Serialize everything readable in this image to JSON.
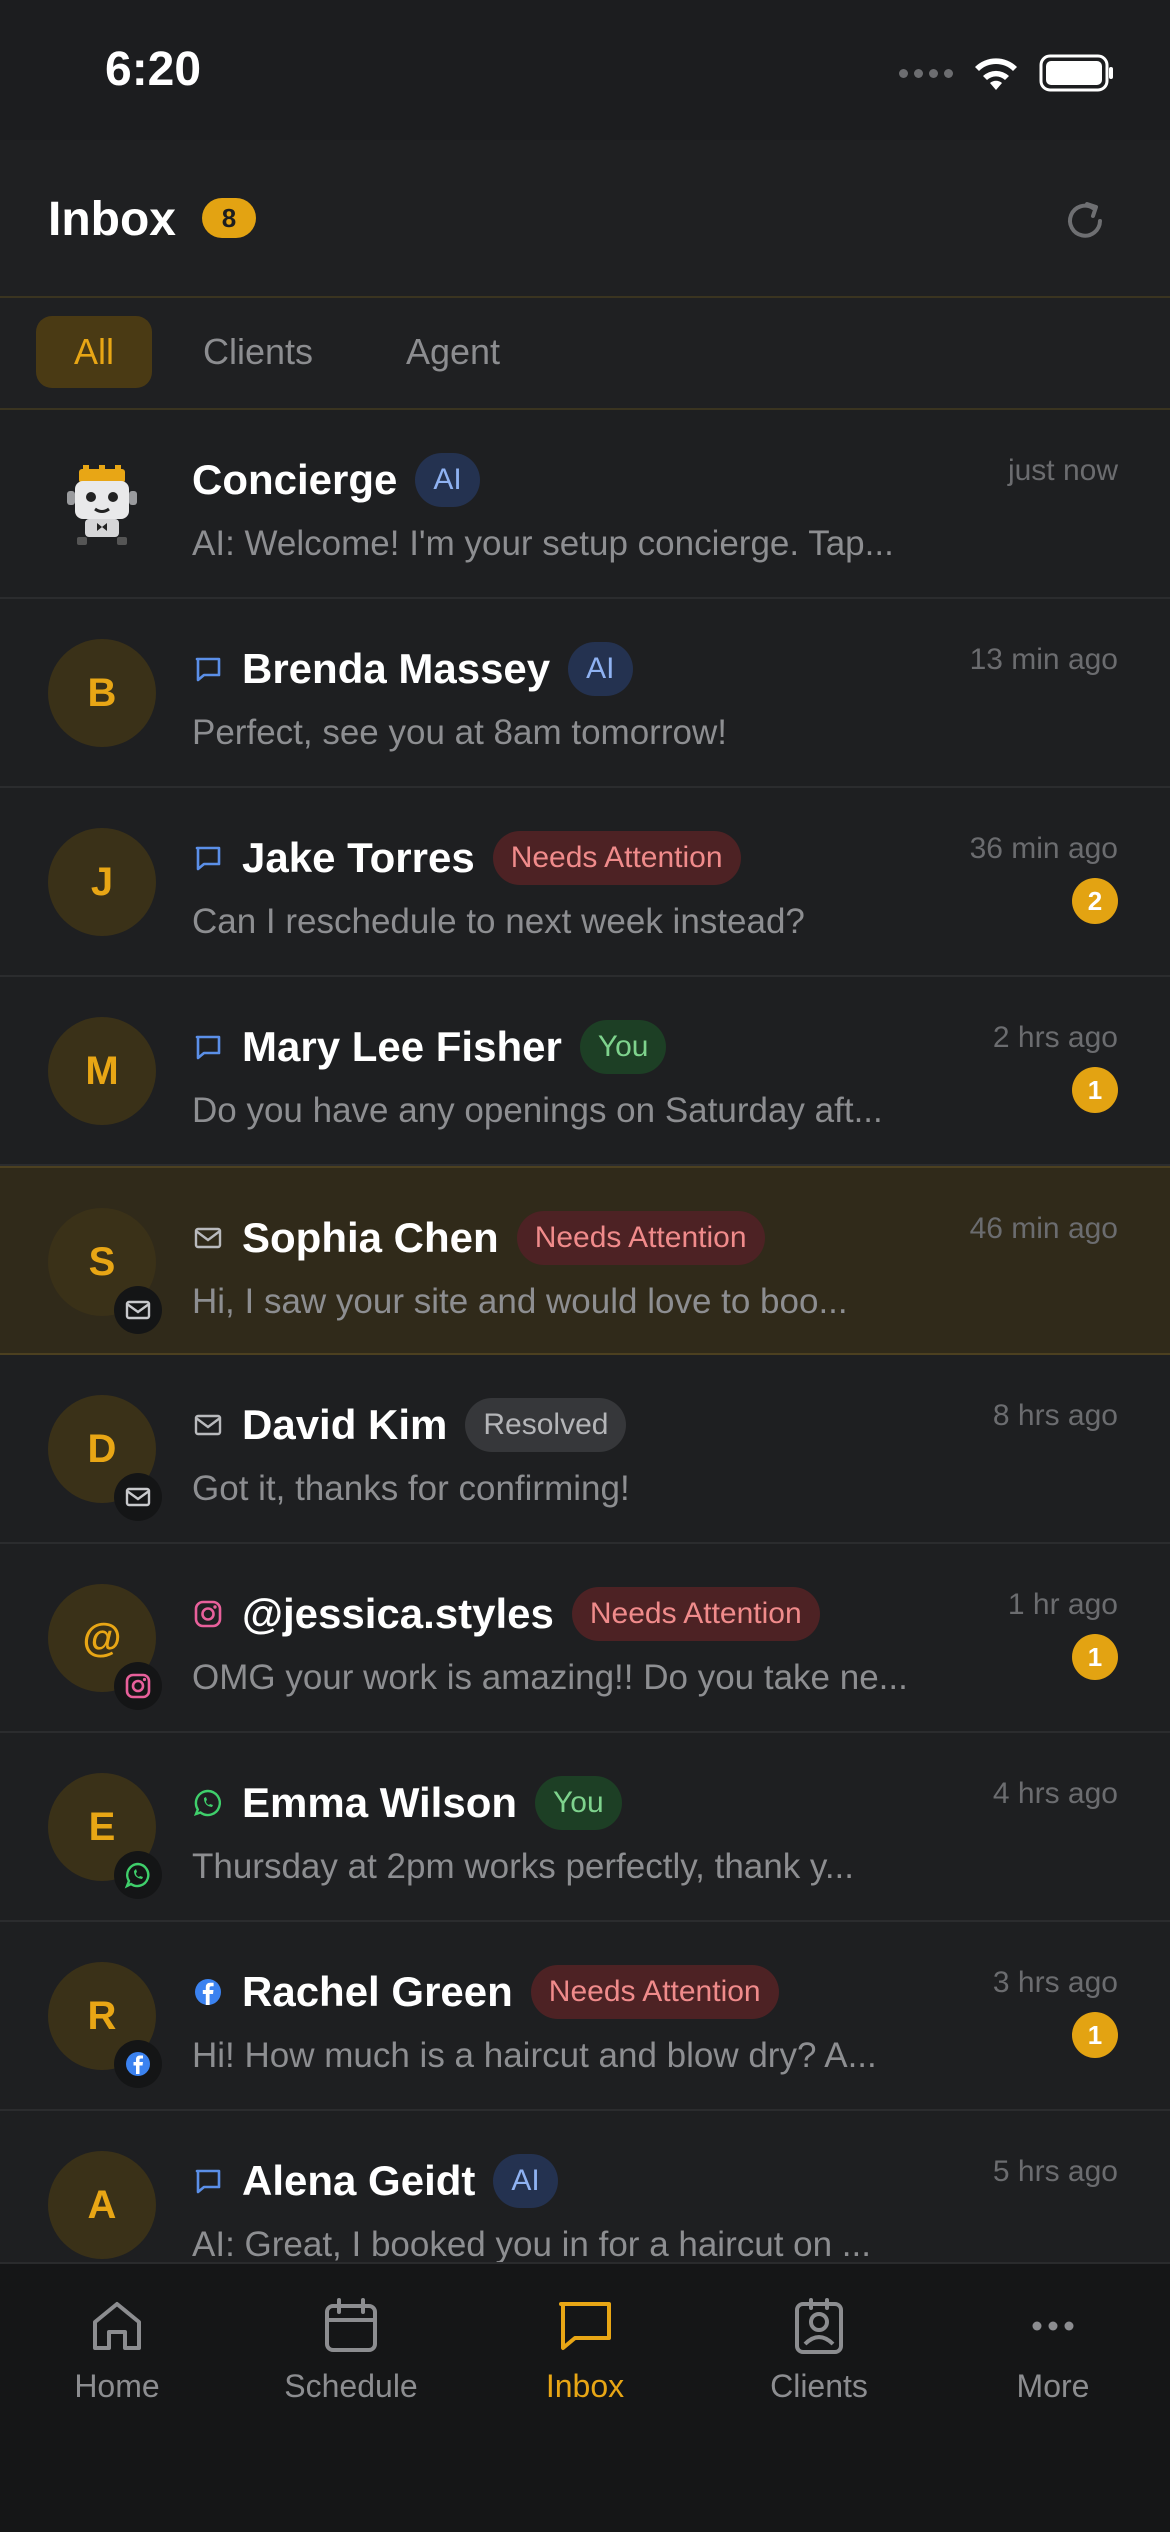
{
  "status_bar": {
    "time": "6:20"
  },
  "header": {
    "title": "Inbox",
    "unread_count": "8"
  },
  "tabs": [
    {
      "label": "All",
      "active": true
    },
    {
      "label": "Clients",
      "active": false
    },
    {
      "label": "Agent",
      "active": false
    }
  ],
  "conversations": [
    {
      "name": "Concierge",
      "avatar": "",
      "channel": "none",
      "tag": "AI",
      "tag_type": "ai",
      "preview": "AI: Welcome! I'm your setup concierge. Tap...",
      "time": "just now",
      "unread": ""
    },
    {
      "name": "Brenda Massey",
      "avatar": "B",
      "channel": "chat",
      "tag": "AI",
      "tag_type": "ai",
      "preview": "Perfect, see you at 8am tomorrow!",
      "time": "13 min ago",
      "unread": ""
    },
    {
      "name": "Jake Torres",
      "avatar": "J",
      "channel": "chat",
      "tag": "Needs Attention",
      "tag_type": "attn",
      "preview": "Can I reschedule to next week instead?",
      "time": "36 min ago",
      "unread": "2"
    },
    {
      "name": "Mary Lee Fisher",
      "avatar": "M",
      "channel": "chat",
      "tag": "You",
      "tag_type": "you",
      "preview": "Do you have any openings on Saturday aft...",
      "time": "2 hrs ago",
      "unread": "1"
    },
    {
      "name": "Sophia Chen",
      "avatar": "S",
      "channel": "email",
      "tag": "Needs Attention",
      "tag_type": "attn",
      "preview": "Hi, I saw your site and would love to boo...",
      "time": "46 min ago",
      "unread": ""
    },
    {
      "name": "David Kim",
      "avatar": "D",
      "channel": "email",
      "tag": "Resolved",
      "tag_type": "resolved",
      "preview": "Got it, thanks for confirming!",
      "time": "8 hrs ago",
      "unread": ""
    },
    {
      "name": "@jessica.styles",
      "avatar": "@",
      "channel": "instagram",
      "tag": "Needs Attention",
      "tag_type": "attn",
      "preview": "OMG your work is amazing!! Do you take ne...",
      "time": "1 hr ago",
      "unread": "1"
    },
    {
      "name": "Emma Wilson",
      "avatar": "E",
      "channel": "whatsapp",
      "tag": "You",
      "tag_type": "you",
      "preview": "Thursday at 2pm works perfectly, thank y...",
      "time": "4 hrs ago",
      "unread": ""
    },
    {
      "name": "Rachel Green",
      "avatar": "R",
      "channel": "facebook",
      "tag": "Needs Attention",
      "tag_type": "attn",
      "preview": "Hi! How much is a haircut and blow dry? A...",
      "time": "3 hrs ago",
      "unread": "1"
    },
    {
      "name": "Alena Geidt",
      "avatar": "A",
      "channel": "chat",
      "tag": "AI",
      "tag_type": "ai",
      "preview": "AI: Great, I booked you in for a haircut on ...",
      "time": "5 hrs ago",
      "unread": ""
    }
  ],
  "bottom_nav": [
    {
      "label": "Home",
      "icon": "home-icon",
      "active": false
    },
    {
      "label": "Schedule",
      "icon": "calendar-icon",
      "active": false
    },
    {
      "label": "Inbox",
      "icon": "message-icon",
      "active": true
    },
    {
      "label": "Clients",
      "icon": "contacts-icon",
      "active": false
    },
    {
      "label": "More",
      "icon": "more-icon",
      "active": false
    }
  ],
  "colors": {
    "accent": "#e3a312",
    "background": "#1c1d1f",
    "attention": "#f08b8b",
    "ai": "#8fb2f2",
    "you": "#7ed38d"
  }
}
